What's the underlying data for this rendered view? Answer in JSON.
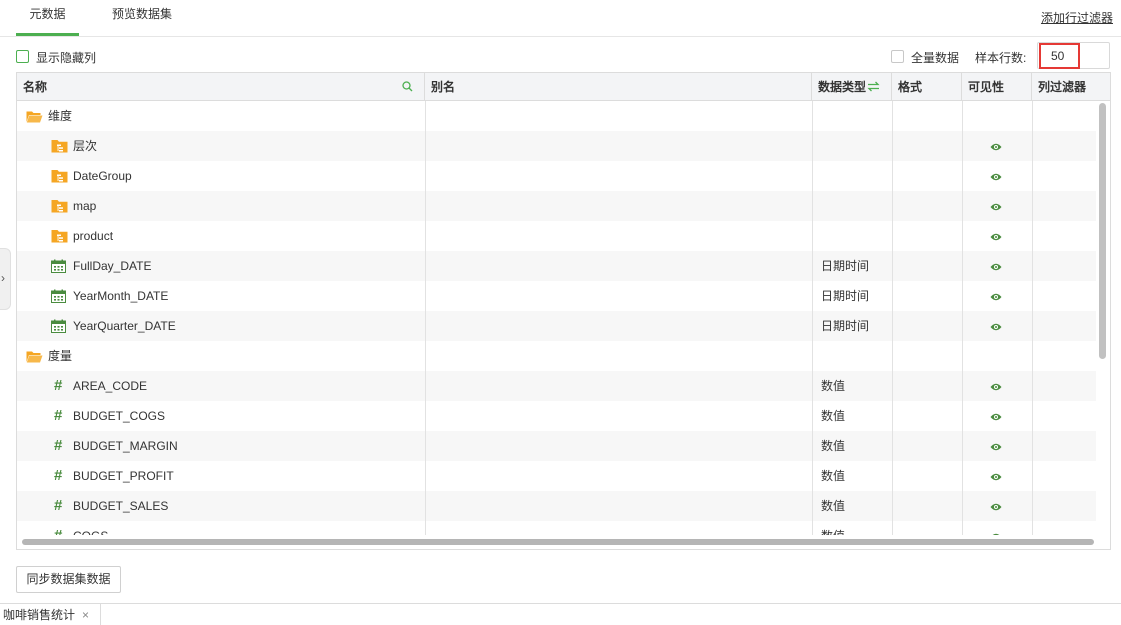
{
  "tabs": [
    {
      "label": "元数据",
      "active": true
    },
    {
      "label": "预览数据集",
      "active": false
    }
  ],
  "add_row_filter_label": "添加行过滤器",
  "options": {
    "show_hidden_columns_label": "显示隐藏列",
    "full_data_label": "全量数据",
    "sample_rows_label": "样本行数:",
    "sample_rows_value": "50"
  },
  "table": {
    "columns": [
      "名称",
      "别名",
      "数据类型",
      "格式",
      "可见性",
      "列过滤器"
    ],
    "rows": [
      {
        "name": "维度",
        "icon": "folder-open-icon",
        "type": "",
        "visible": false,
        "level": 0
      },
      {
        "name": "层次",
        "icon": "hierarchy-folder-icon",
        "type": "",
        "visible": true,
        "level": 1
      },
      {
        "name": "DateGroup",
        "icon": "hierarchy-folder-icon",
        "type": "",
        "visible": true,
        "level": 1
      },
      {
        "name": "map",
        "icon": "hierarchy-folder-icon",
        "type": "",
        "visible": true,
        "level": 1
      },
      {
        "name": "product",
        "icon": "hierarchy-folder-icon",
        "type": "",
        "visible": true,
        "level": 1
      },
      {
        "name": "FullDay_DATE",
        "icon": "calendar-icon",
        "type": "日期时间",
        "visible": true,
        "level": 1
      },
      {
        "name": "YearMonth_DATE",
        "icon": "calendar-icon",
        "type": "日期时间",
        "visible": true,
        "level": 1
      },
      {
        "name": "YearQuarter_DATE",
        "icon": "calendar-icon",
        "type": "日期时间",
        "visible": true,
        "level": 1
      },
      {
        "name": "度量",
        "icon": "folder-open-icon",
        "type": "",
        "visible": false,
        "level": 0
      },
      {
        "name": "AREA_CODE",
        "icon": "number-icon",
        "type": "数值",
        "visible": true,
        "level": 1
      },
      {
        "name": "BUDGET_COGS",
        "icon": "number-icon",
        "type": "数值",
        "visible": true,
        "level": 1
      },
      {
        "name": "BUDGET_MARGIN",
        "icon": "number-icon",
        "type": "数值",
        "visible": true,
        "level": 1
      },
      {
        "name": "BUDGET_PROFIT",
        "icon": "number-icon",
        "type": "数值",
        "visible": true,
        "level": 1
      },
      {
        "name": "BUDGET_SALES",
        "icon": "number-icon",
        "type": "数值",
        "visible": true,
        "level": 1
      },
      {
        "name": "COGS",
        "icon": "number-icon",
        "type": "数值",
        "visible": true,
        "level": 1
      }
    ]
  },
  "sync_button_label": "同步数据集数据",
  "bottom_tab": {
    "label": "咖啡销售统计",
    "close": "×"
  },
  "colors": {
    "accent": "#4caf50",
    "highlight_border": "#e53935",
    "folder": "#f5a623",
    "icon_green": "#4a8c3f"
  }
}
